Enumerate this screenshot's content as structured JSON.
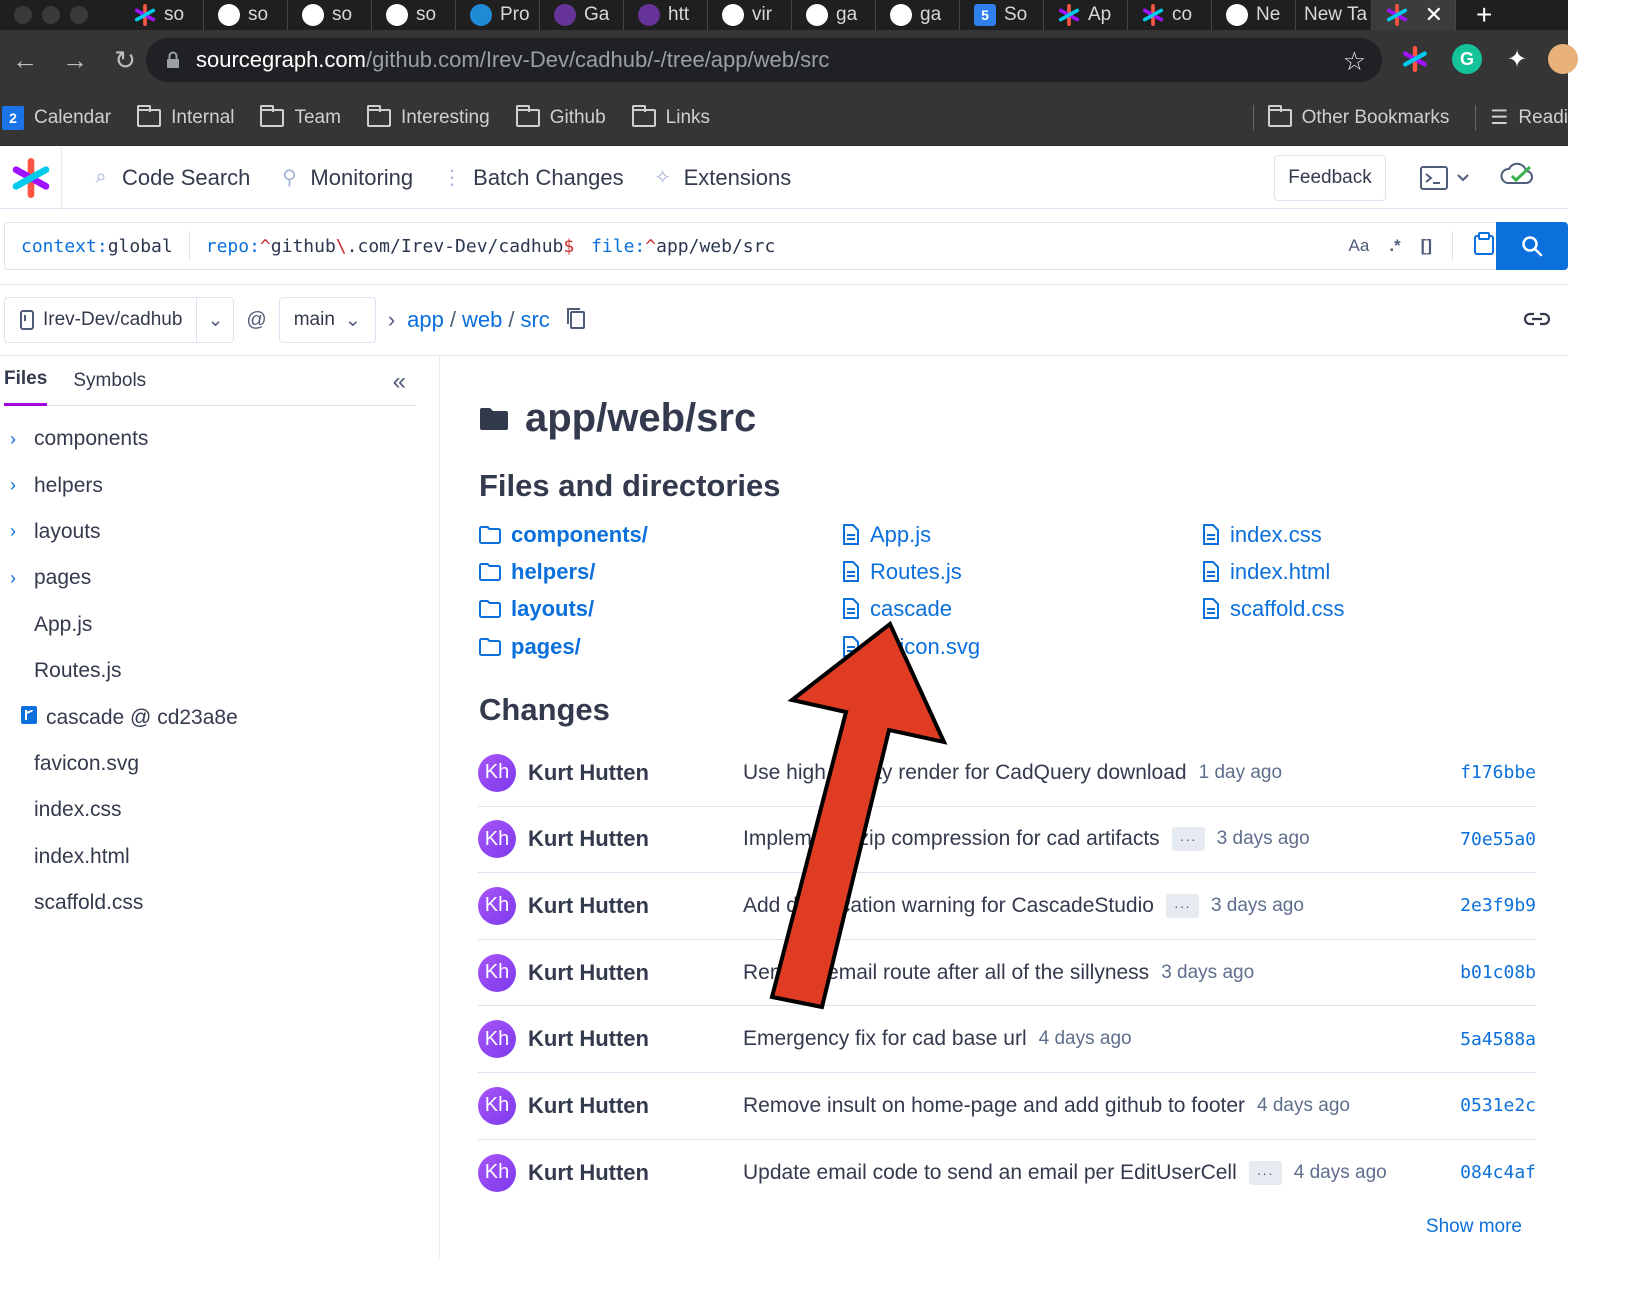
{
  "browser": {
    "tabs": [
      {
        "label": "so",
        "icon": "sourcegraph-icon"
      },
      {
        "label": "so",
        "icon": "github-icon"
      },
      {
        "label": "so",
        "icon": "github-icon"
      },
      {
        "label": "so",
        "icon": "github-icon"
      },
      {
        "label": "Pro",
        "icon": "prime-icon"
      },
      {
        "label": "Ga",
        "icon": "gatsby-icon"
      },
      {
        "label": "htt",
        "icon": "gatsby-icon"
      },
      {
        "label": "vir",
        "icon": "github-icon"
      },
      {
        "label": "ga",
        "icon": "github-icon"
      },
      {
        "label": "ga",
        "icon": "github-icon"
      },
      {
        "label": "So",
        "icon": "five-icon"
      },
      {
        "label": "Ap",
        "icon": "sourcegraph-icon"
      },
      {
        "label": "co",
        "icon": "sourcegraph-icon"
      },
      {
        "label": "Ne",
        "icon": "github-icon"
      }
    ],
    "new_tab_label": "New Ta",
    "url_host": "sourcegraph.com",
    "url_path": "/github.com/Irev-Dev/cadhub/-/tree/app/web/src",
    "bookmarks": [
      "Calendar",
      "Internal",
      "Team",
      "Interesting",
      "Github",
      "Links"
    ],
    "calendar_day": "2",
    "other_bookmarks": "Other Bookmarks",
    "reading_list": "Readi"
  },
  "nav": {
    "items": [
      "Code Search",
      "Monitoring",
      "Batch Changes",
      "Extensions"
    ],
    "feedback": "Feedback"
  },
  "search": {
    "context_kw": "context:",
    "context_val": "global",
    "repo_kw": "repo:",
    "repo_a": "^github",
    "repo_escape": "\\.",
    "repo_b": "com/Irev-Dev/cadhub",
    "repo_end": "$",
    "file_kw": "file:",
    "file_val": "^app/web/src",
    "case_toggle": "Aa",
    "regex_toggle": ".*",
    "structural_toggle": "[]"
  },
  "repo": {
    "name": "Irev-Dev/cadhub",
    "at": "@",
    "branch": "main",
    "crumbs": [
      "app",
      "web",
      "src"
    ]
  },
  "sidebar": {
    "tabs": [
      "Files",
      "Symbols"
    ],
    "tree": [
      {
        "label": "components",
        "dir": true
      },
      {
        "label": "helpers",
        "dir": true
      },
      {
        "label": "layouts",
        "dir": true
      },
      {
        "label": "pages",
        "dir": true
      },
      {
        "label": "App.js"
      },
      {
        "label": "Routes.js"
      },
      {
        "label": "cascade @ cd23a8e",
        "submodule": true
      },
      {
        "label": "favicon.svg"
      },
      {
        "label": "index.css"
      },
      {
        "label": "index.html"
      },
      {
        "label": "scaffold.css"
      }
    ]
  },
  "main": {
    "title": "app/web/src",
    "files_heading": "Files and directories",
    "col1": [
      "components/",
      "helpers/",
      "layouts/",
      "pages/"
    ],
    "col2": [
      "App.js",
      "Routes.js",
      "cascade",
      "favicon.svg"
    ],
    "col3": [
      "index.css",
      "index.html",
      "scaffold.css"
    ],
    "changes_heading": "Changes",
    "avatar_initials": "Kh",
    "commits": [
      {
        "author": "Kurt Hutten",
        "message": "Use high quality render for CadQuery download",
        "more": false,
        "ago": "1 day ago",
        "sha": "f176bbe"
      },
      {
        "author": "Kurt Hutten",
        "message": "Implement gzip compression for cad artifacts",
        "more": true,
        "ago": "3 days ago",
        "sha": "70e55a0"
      },
      {
        "author": "Kurt Hutten",
        "message": "Add deprecation warning for CascadeStudio",
        "more": true,
        "ago": "3 days ago",
        "sha": "2e3f9b9"
      },
      {
        "author": "Kurt Hutten",
        "message": "Remove email route after all of the sillyness",
        "more": false,
        "ago": "3 days ago",
        "sha": "b01c08b"
      },
      {
        "author": "Kurt Hutten",
        "message": "Emergency fix for cad base url",
        "more": false,
        "ago": "4 days ago",
        "sha": "5a4588a"
      },
      {
        "author": "Kurt Hutten",
        "message": "Remove insult on home-page and add github to footer",
        "more": false,
        "ago": "4 days ago",
        "sha": "0531e2c"
      },
      {
        "author": "Kurt Hutten",
        "message": "Update email code to send an email per EditUserCell",
        "more": true,
        "ago": "4 days ago",
        "sha": "084c4af"
      }
    ],
    "show_more": "Show more"
  },
  "colors": {
    "link": "#0b70db",
    "annotation_arrow": "#e03c24",
    "avatar": "#8b5cf6",
    "tab_accent": "#a305e1"
  }
}
